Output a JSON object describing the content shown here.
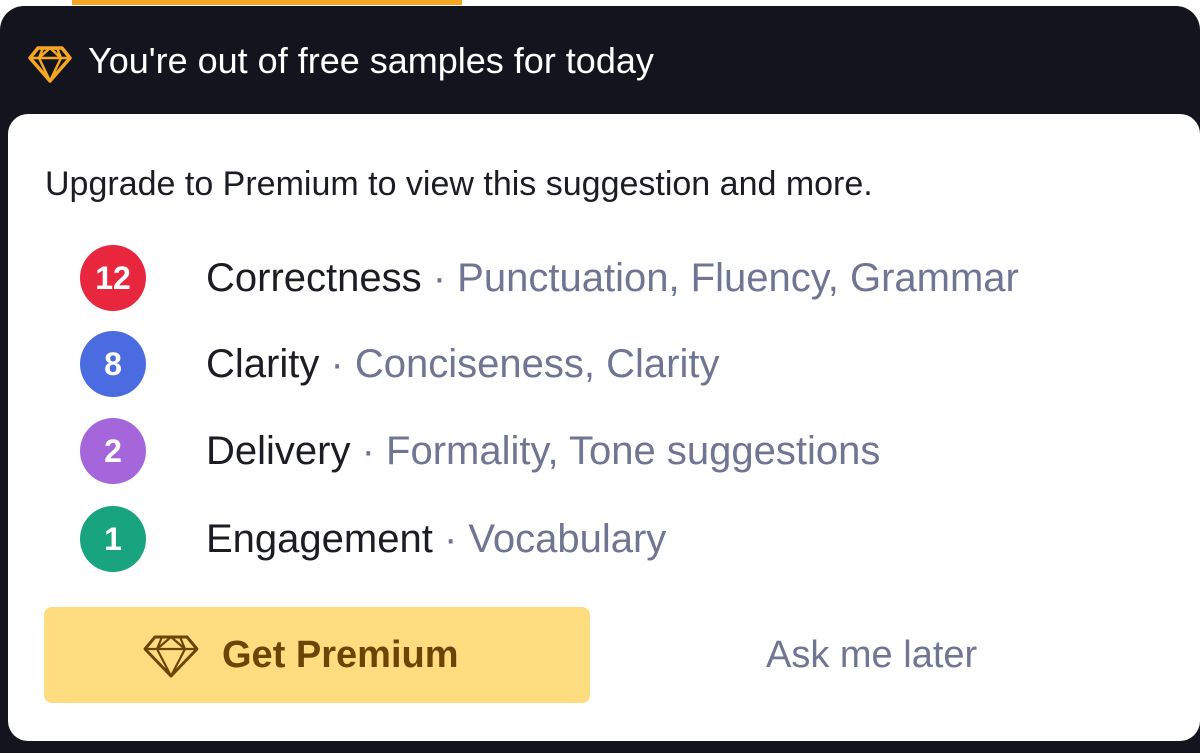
{
  "header": {
    "icon": "diamond-icon",
    "text": "You're out of free samples for today"
  },
  "card": {
    "intro": "Upgrade to Premium to view this suggestion and more.",
    "categories": [
      {
        "count": "12",
        "name": "Correctness",
        "separator": " · ",
        "details": "Punctuation, Fluency, Grammar",
        "color": "#e8273e"
      },
      {
        "count": "8",
        "name": "Clarity",
        "separator": " · ",
        "details": "Conciseness, Clarity",
        "color": "#4b6be0"
      },
      {
        "count": "2",
        "name": "Delivery",
        "separator": " · ",
        "details": "Formality, Tone suggestions",
        "color": "#a566dc"
      },
      {
        "count": "1",
        "name": "Engagement",
        "separator": " · ",
        "details": "Vocabulary",
        "color": "#17a47e"
      }
    ],
    "actions": {
      "premium_label": "Get Premium",
      "premium_icon": "diamond-icon",
      "later_label": "Ask me later"
    }
  },
  "colors": {
    "panel_bg": "#13141d",
    "accent": "#f5a623",
    "premium_bg": "#fedd80",
    "premium_text": "#6b4505",
    "muted_text": "#6f7592"
  }
}
